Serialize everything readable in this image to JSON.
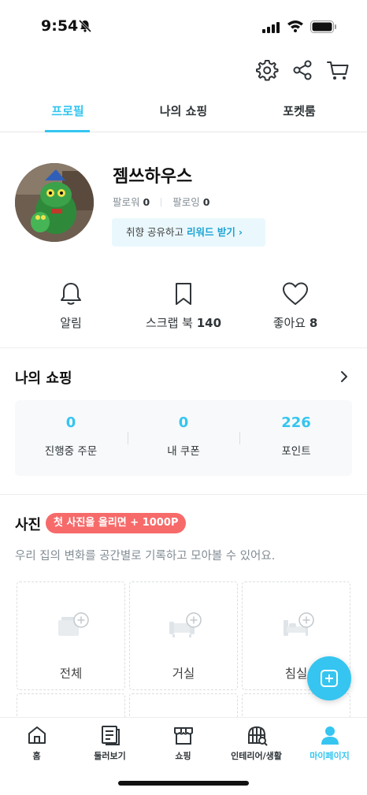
{
  "status_bar": {
    "time": "9:54"
  },
  "tabs": [
    {
      "label": "프로필",
      "active": true
    },
    {
      "label": "나의 쇼핑",
      "active": false
    },
    {
      "label": "포켓룸",
      "active": false
    }
  ],
  "profile": {
    "name": "젬쓰하우스",
    "followers_label": "팔로워",
    "followers_count": "0",
    "following_label": "팔로잉",
    "following_count": "0",
    "reward_prefix": "취향 공유하고",
    "reward_link": "리워드 받기",
    "reward_chevron": "›"
  },
  "quick_actions": [
    {
      "label": "알림",
      "count": "",
      "icon": "bell-icon"
    },
    {
      "label": "스크랩 북",
      "count": "140",
      "icon": "bookmark-icon"
    },
    {
      "label": "좋아요",
      "count": "8",
      "icon": "heart-icon"
    }
  ],
  "my_shopping": {
    "title": "나의 쇼핑",
    "stats": [
      {
        "value": "0",
        "label": "진행중 주문"
      },
      {
        "value": "0",
        "label": "내 쿠폰"
      },
      {
        "value": "226",
        "label": "포인트"
      }
    ]
  },
  "photo": {
    "title": "사진",
    "badge": "첫 사진을 올리면 + 1000P",
    "description": "우리 집의 변화를 공간별로 기록하고 모아볼 수 있어요.",
    "cells": [
      "전체",
      "거실",
      "침실"
    ]
  },
  "bottom_nav": [
    {
      "label": "홈",
      "icon": "home-icon",
      "active": false
    },
    {
      "label": "둘러보기",
      "icon": "browse-icon",
      "active": false
    },
    {
      "label": "쇼핑",
      "icon": "shop-icon",
      "active": false
    },
    {
      "label": "인테리어/생활",
      "icon": "interior-icon",
      "active": false
    },
    {
      "label": "마이페이지",
      "icon": "person-icon",
      "active": true
    }
  ],
  "colors": {
    "accent": "#35c5f0",
    "badge": "#f76a6a",
    "text": "#2f3438",
    "muted": "#828c94"
  }
}
